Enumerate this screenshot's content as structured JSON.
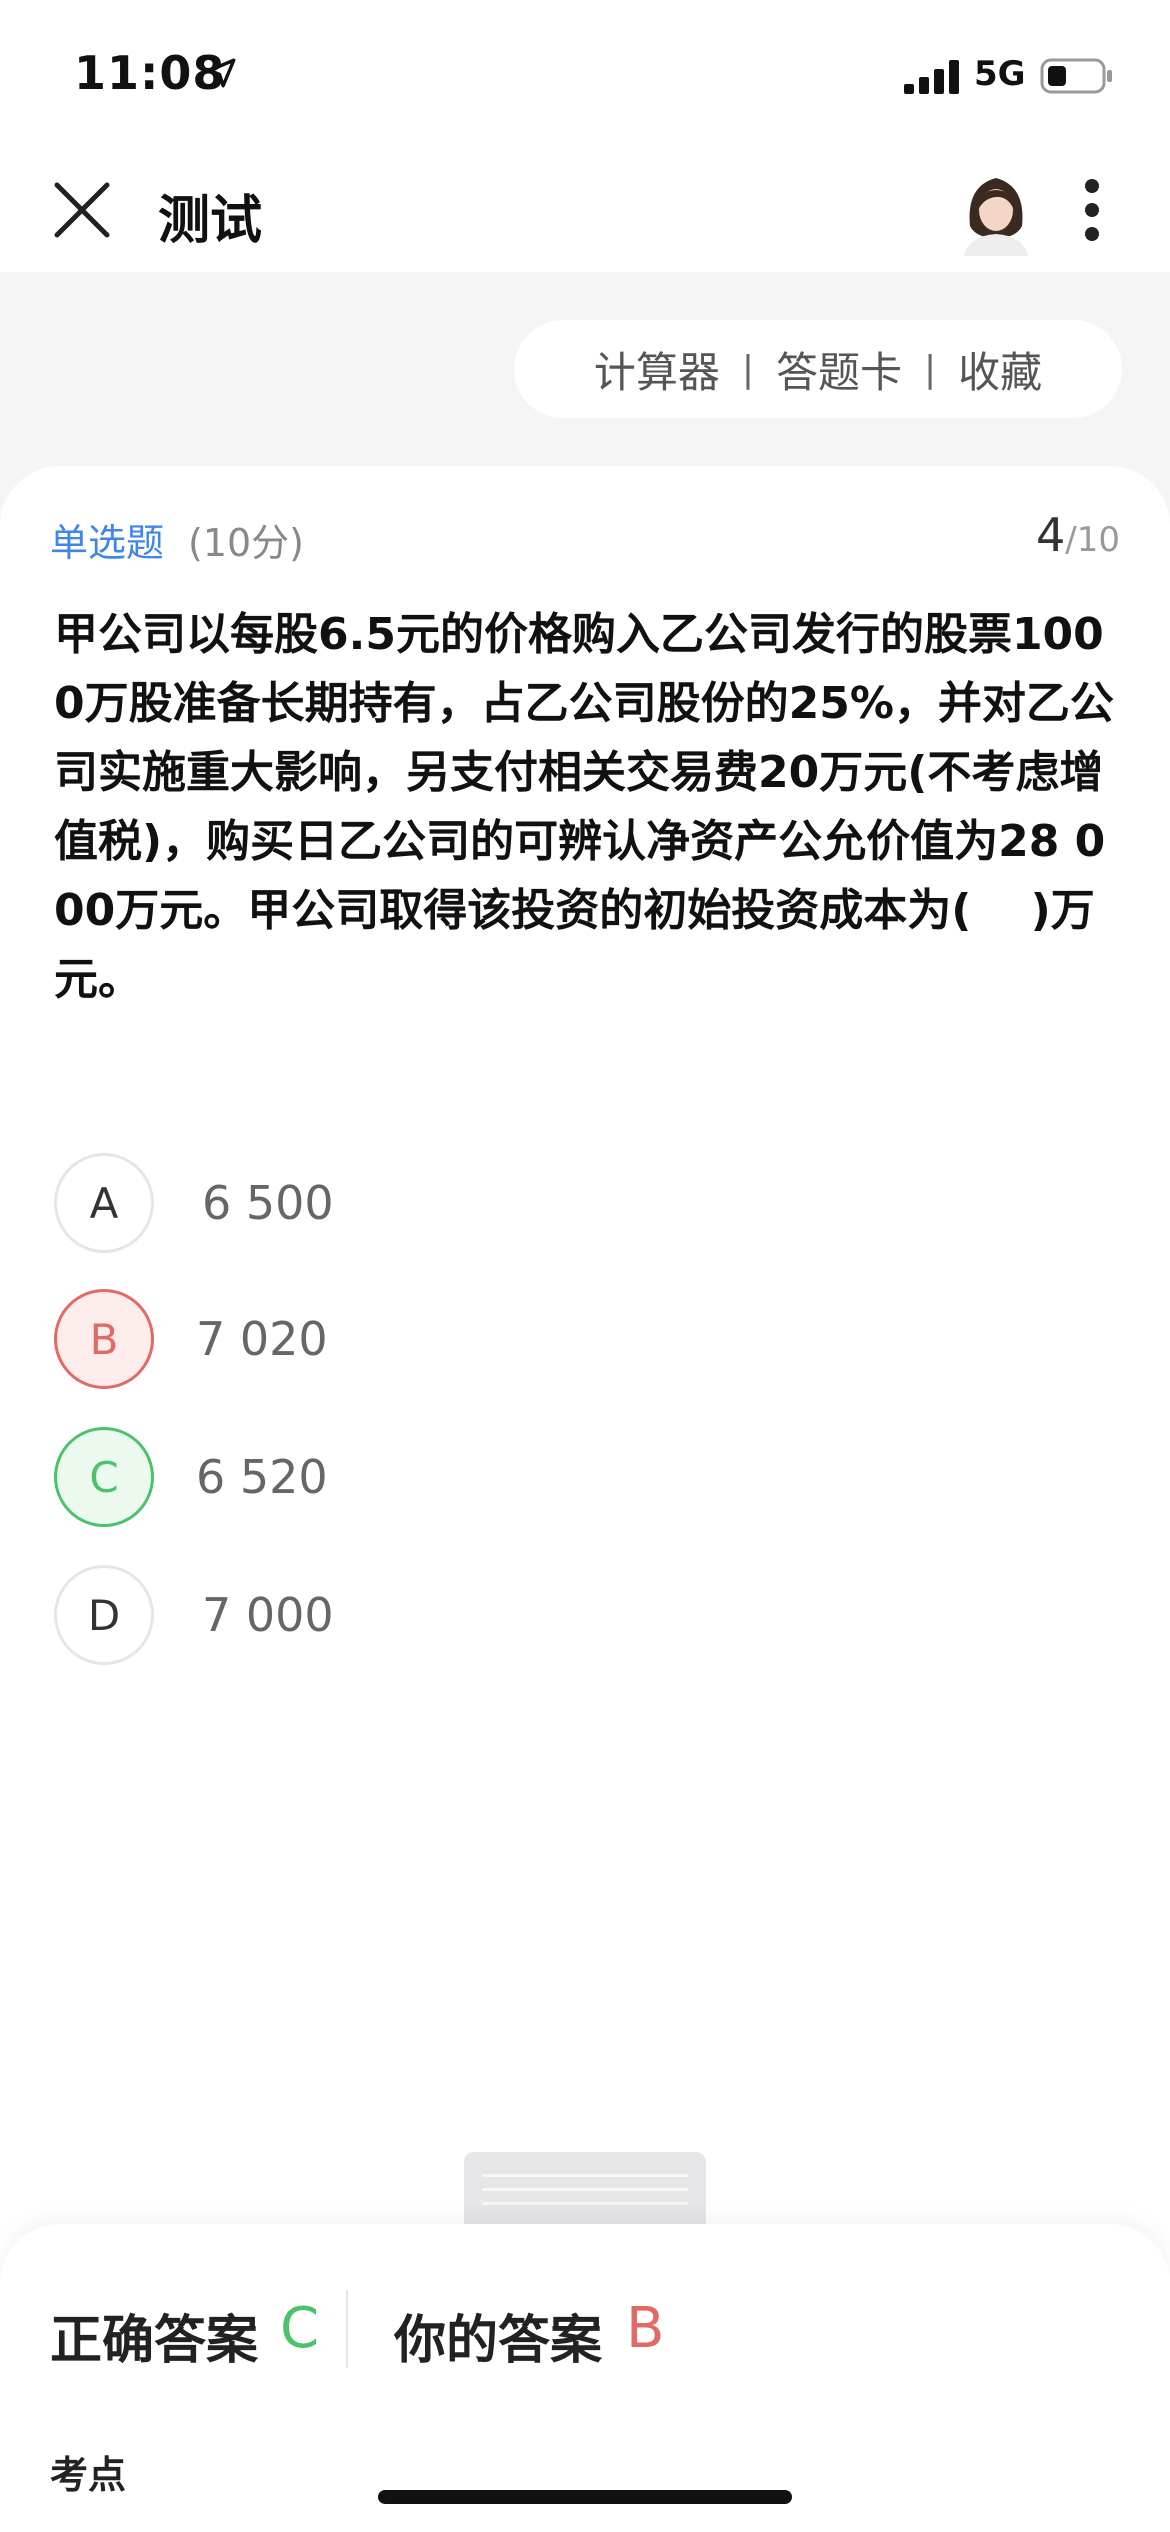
{
  "status_bar": {
    "time": "11:08",
    "network": "5G"
  },
  "nav": {
    "title": "测试"
  },
  "tools": {
    "calculator": "计算器",
    "separator": "|",
    "answer_card": "答题卡",
    "favorite": "收藏"
  },
  "question": {
    "type": "单选题",
    "score": "(10分)",
    "current": "4",
    "total": "/10",
    "text": "甲公司以每股6.5元的价格购入乙公司发行的股票1000万股准备长期持有，占乙公司股份的25%，并对乙公司实施重大影响，另支付相关交易费20万元(不考虑增值税)，购买日乙公司的可辨认净资产公允价值为28 000万元。甲公司取得该投资的初始投资成本为(　 )万元。"
  },
  "options": [
    {
      "letter": "A",
      "text": "6 500",
      "state": "normal"
    },
    {
      "letter": "B",
      "text": "7 020",
      "state": "wrong"
    },
    {
      "letter": "C",
      "text": "6 520",
      "state": "correct"
    },
    {
      "letter": "D",
      "text": "7 000",
      "state": "normal"
    }
  ],
  "answer": {
    "correct_label": "正确答案",
    "correct_value": "C",
    "yours_label": "你的答案",
    "yours_value": "B",
    "section_title": "考点"
  },
  "colors": {
    "accent": "#3f86e8",
    "correct": "#4cc26a",
    "wrong": "#e16a66"
  }
}
